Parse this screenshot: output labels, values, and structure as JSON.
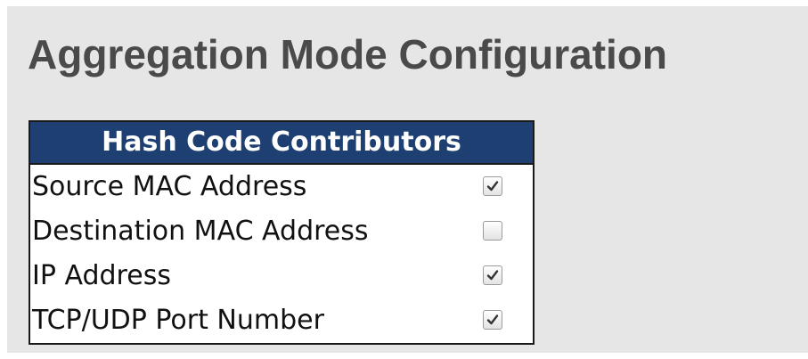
{
  "page": {
    "title": "Aggregation Mode Configuration"
  },
  "hash_table": {
    "header": "Hash Code Contributors",
    "rows": [
      {
        "label": "Source MAC Address",
        "checked": true
      },
      {
        "label": "Destination MAC Address",
        "checked": false
      },
      {
        "label": "IP Address",
        "checked": true
      },
      {
        "label": "TCP/UDP Port Number",
        "checked": true
      }
    ]
  },
  "colors": {
    "page_background": "#e6e6e6",
    "title_text": "#4a4a4a",
    "header_background": "#1d3f72",
    "header_text": "#ffffff",
    "table_border": "#1a1a1a",
    "checkmark": "#333333"
  },
  "icons": {
    "checkbox_mark": "check-icon"
  }
}
